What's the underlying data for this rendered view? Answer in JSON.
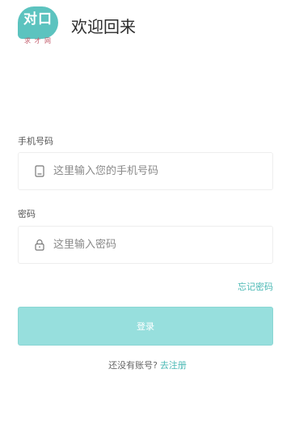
{
  "header": {
    "logo_text": "对口",
    "logo_sub": "求 才 网",
    "welcome": "欢迎回来"
  },
  "phone": {
    "label": "手机号码",
    "placeholder": "这里输入您的手机号码",
    "value": "",
    "icon": "phone-icon"
  },
  "password": {
    "label": "密码",
    "placeholder": "这里输入密码",
    "value": "",
    "icon": "lock-icon"
  },
  "forgot_label": "忘记密码",
  "login_label": "登录",
  "register": {
    "prompt": "还没有账号?",
    "link": "去注册"
  },
  "colors": {
    "brand": "#5cc3bf",
    "button": "#97dfdd",
    "link": "#4ab8b4"
  }
}
